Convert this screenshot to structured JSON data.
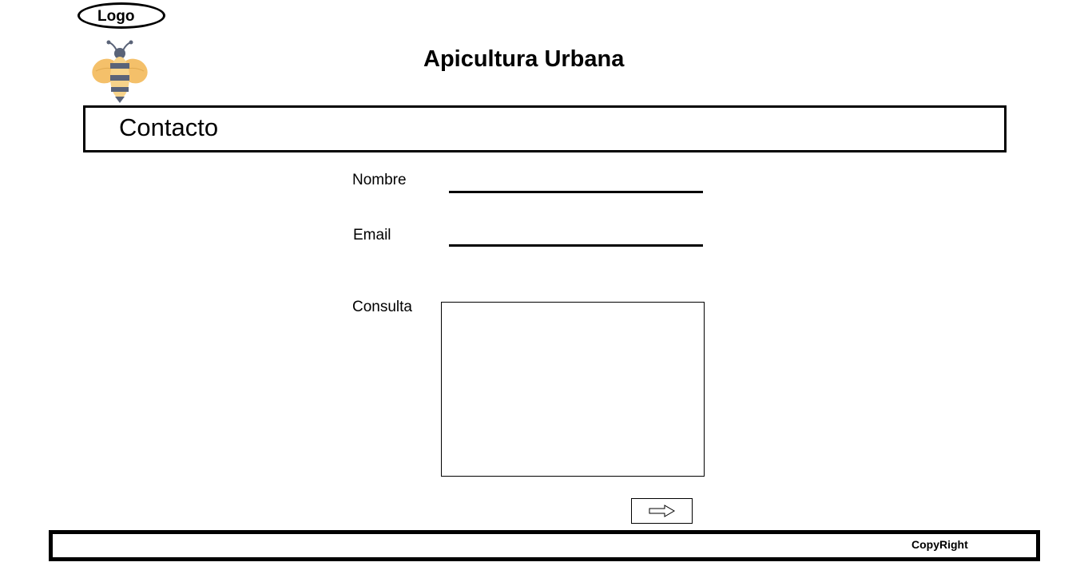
{
  "header": {
    "logo_text": "Logo",
    "site_title": "Apicultura Urbana"
  },
  "section": {
    "title": "Contacto"
  },
  "form": {
    "nombre_label": "Nombre",
    "nombre_value": "",
    "email_label": "Email",
    "email_value": "",
    "consulta_label": "Consulta",
    "consulta_value": ""
  },
  "footer": {
    "copyright": "CopyRight"
  },
  "icons": {
    "logo_image": "bee-icon",
    "submit": "arrow-right-icon"
  },
  "colors": {
    "bee_wing": "#f4c06a",
    "bee_body_dark": "#5a6378",
    "bee_stripe": "#f7d38a"
  }
}
